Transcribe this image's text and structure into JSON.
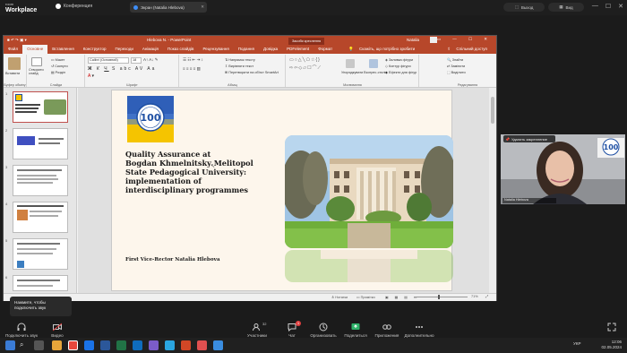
{
  "app": {
    "brand_top": "room",
    "brand": "Workplace",
    "conference_label": "Конференция",
    "screen_tab_label": "Экран (Natalia Hlebova)",
    "exit_label": "Выход",
    "video_label": "Вид"
  },
  "ppt": {
    "title_center": "Hlebova N. - PowerPoint",
    "search_hint": "Скажіть, що потрібно зробити",
    "user": "Natalia",
    "tabs": [
      "Файл",
      "Основне",
      "Вставлення",
      "Конструктор",
      "Переходи",
      "Анімація",
      "Показ слайдів",
      "Рецензування",
      "Подання",
      "Довідка",
      "PDFelement",
      "Формат"
    ],
    "active_tab": "Основне",
    "drawing_tools_label": "Засоби креслення",
    "share_label": "Спільний доступ",
    "ribbon_groups": [
      "Буфер обміну",
      "Слайди",
      "Шрифт",
      "Абзац",
      "Малювання",
      "Редагування"
    ],
    "ribbon_items": {
      "paste": "Вставити",
      "new_slide": "Створити слайд",
      "layout": "Макет",
      "reset": "Скинути",
      "section": "Розділ",
      "font_name": "Calibri (Основний)",
      "font_size": "18",
      "text_direction": "Напрямок тексту",
      "align_text": "Вирівняти текст",
      "convert_smartart": "Перетворити на об'єкт SmartArt",
      "arrange": "Упорядкувати",
      "quick_styles": "Експрес-стилі",
      "shape_fill": "Заливка фігури",
      "shape_outline": "Контур фігури",
      "shape_effects": "Ефекти для фігур",
      "find": "Знайти",
      "replace": "Замінити",
      "select": "Виділити"
    },
    "status": {
      "notes": "Нотатки",
      "comments": "Примітки",
      "zoom": "71%"
    },
    "slide_numbers": [
      "1",
      "2",
      "3",
      "4",
      "5",
      "6",
      "7"
    ]
  },
  "slide": {
    "title": "Quality Assurance at\nBogdan Khmelnitsky Melitopol\nState Pedagogical University:\nimplementation of\ninterdisciplinary programmes",
    "author": "First Vice-Rector Natalia Hlebova",
    "logo_text": "100"
  },
  "webcam": {
    "pin_label": "Удалить закрепление",
    "participant_name": "Natalia Hlebova",
    "logo_text": "100"
  },
  "tooltip": {
    "text": "Нажмите, чтобы подключить звук"
  },
  "conference_toolbar": {
    "audio": "Подключить звук",
    "video": "Видео",
    "participants": "Участники",
    "participants_count": "32",
    "chat": "Чат",
    "chat_badge": "1",
    "moderate": "Организовать",
    "share": "Поделиться",
    "apps": "Приложения",
    "more": "Дополнительно"
  },
  "taskbar": {
    "lang": "УКР",
    "time": "12:06",
    "date": "02.05.2024"
  },
  "colors": {
    "ppt_accent": "#b7472a",
    "brand_blue": "#1e4fa3",
    "brand_yellow": "#f5c400"
  }
}
